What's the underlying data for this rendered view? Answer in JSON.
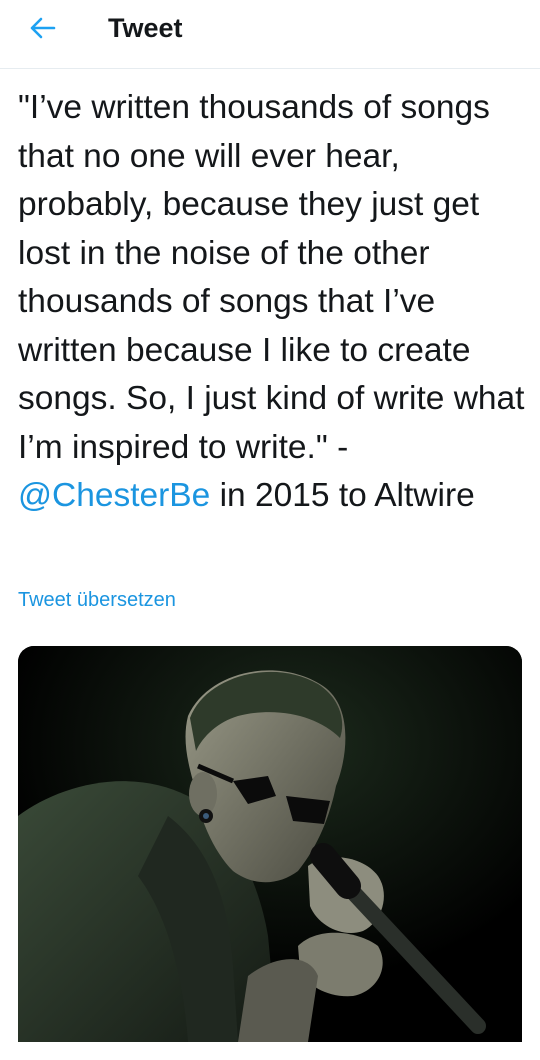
{
  "header": {
    "title": "Tweet",
    "back_icon": "arrow-left-icon",
    "accent_color": "#1da1f2"
  },
  "tweet": {
    "text_before": "\"I’ve written thousands of songs that no one will ever hear, probably, because they just get lost in the noise of the other thousands of songs that I’ve written because I like to create songs. So, I just kind of write what I’m inspired to write.\" - ",
    "mention": "@ChesterBe",
    "text_after": " in 2015 to Altwire",
    "translate_label": "Tweet übersetzen",
    "link_color": "#1b95e0"
  },
  "media": {
    "kind": "photo"
  }
}
